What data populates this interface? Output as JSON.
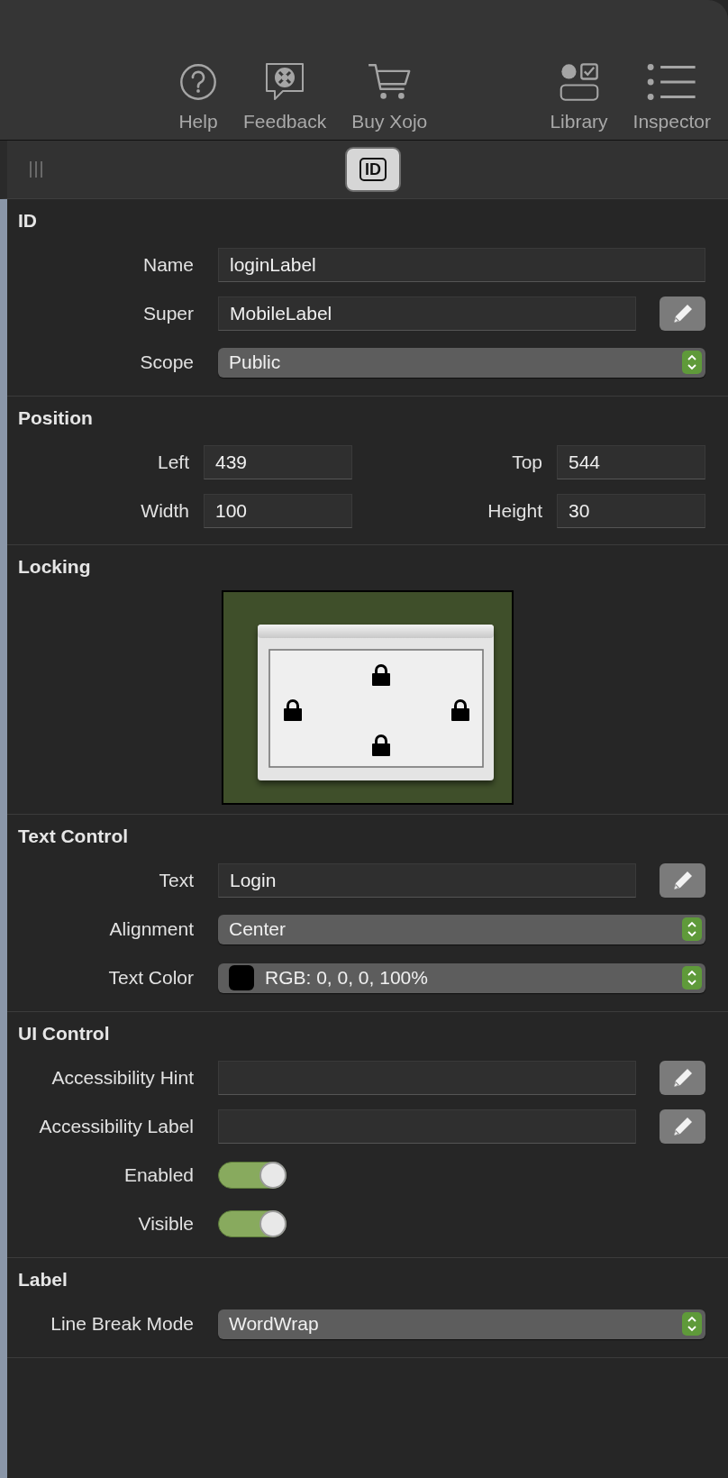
{
  "toolbar": {
    "left_items": [
      {
        "kind": "help",
        "label": "Help"
      },
      {
        "kind": "feedback",
        "label": "Feedback"
      },
      {
        "kind": "cart",
        "label": "Buy Xojo"
      }
    ],
    "right_items": [
      {
        "kind": "library",
        "label": "Library"
      },
      {
        "kind": "inspector",
        "label": "Inspector"
      }
    ]
  },
  "inspector_tabs": [
    {
      "label": "ID",
      "selected": true
    }
  ],
  "sections": [
    {
      "title": "ID",
      "rows": [
        {
          "kind": "text",
          "label": "Name",
          "value": "loginLabel",
          "edit_button": false
        },
        {
          "kind": "text",
          "label": "Super",
          "value": "MobileLabel",
          "edit_button": true
        },
        {
          "kind": "popup",
          "label": "Scope",
          "value": "Public"
        }
      ]
    },
    {
      "title": "Position",
      "rows": [
        {
          "kind": "pair",
          "fields": [
            {
              "label": "Left",
              "value": "439"
            },
            {
              "label": "Top",
              "value": "544"
            }
          ]
        },
        {
          "kind": "pair",
          "fields": [
            {
              "label": "Width",
              "value": "100"
            },
            {
              "label": "Height",
              "value": "30"
            }
          ]
        }
      ]
    },
    {
      "title": "Locking",
      "rows": [
        {
          "kind": "locking",
          "locked_left": true,
          "locked_top": true,
          "locked_right": true,
          "locked_bottom": true
        }
      ]
    },
    {
      "title": "Text Control",
      "rows": [
        {
          "kind": "text",
          "label": "Text",
          "value": "Login",
          "edit_button": true
        },
        {
          "kind": "popup",
          "label": "Alignment",
          "value": "Center"
        },
        {
          "kind": "color_popup",
          "label": "Text Color",
          "color": "#000000",
          "value": "RGB: 0, 0, 0, 100%"
        }
      ]
    },
    {
      "title": "UI Control",
      "rows": [
        {
          "kind": "text",
          "label": "Accessibility Hint",
          "edit_button": true
        },
        {
          "kind": "text",
          "label": "Accessibility Label",
          "edit_button": true
        },
        {
          "kind": "switch",
          "label": "Enabled",
          "on": true
        },
        {
          "kind": "switch",
          "label": "Visible",
          "on": true
        }
      ]
    },
    {
      "title": "Label",
      "rows": [
        {
          "kind": "popup",
          "label": "Line Break Mode",
          "value": "WordWrap"
        }
      ]
    }
  ]
}
